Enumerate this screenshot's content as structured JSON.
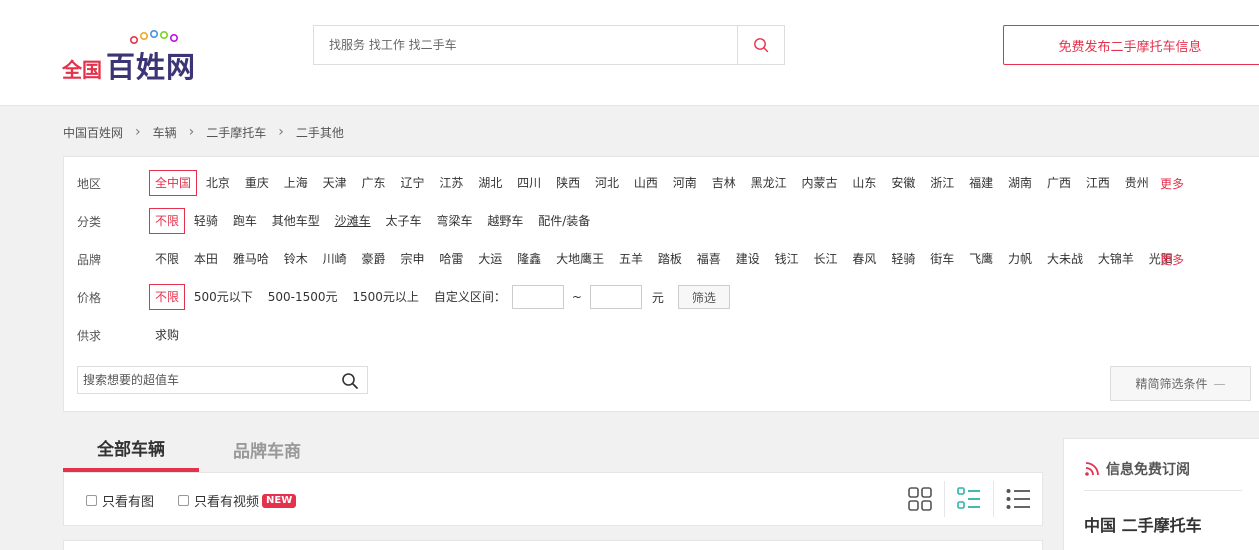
{
  "logo": {
    "prefix": "全国",
    "main": "百姓网"
  },
  "search": {
    "placeholder": "找服务 找工作 找二手车"
  },
  "post_button": "免费发布二手摩托车信息",
  "breadcrumb": [
    "中国百姓网",
    "车辆",
    "二手摩托车",
    "二手其他"
  ],
  "filters": {
    "region": {
      "label": "地区",
      "items": [
        "全中国",
        "北京",
        "重庆",
        "上海",
        "天津",
        "广东",
        "辽宁",
        "江苏",
        "湖北",
        "四川",
        "陕西",
        "河北",
        "山西",
        "河南",
        "吉林",
        "黑龙江",
        "内蒙古",
        "山东",
        "安徽",
        "浙江",
        "福建",
        "湖南",
        "广西",
        "江西",
        "贵州"
      ],
      "selected": "全中国",
      "more": "更多"
    },
    "category": {
      "label": "分类",
      "items": [
        "不限",
        "轻骑",
        "跑车",
        "其他车型",
        "沙滩车",
        "太子车",
        "弯梁车",
        "越野车",
        "配件/装备"
      ],
      "selected": "不限"
    },
    "brand": {
      "label": "品牌",
      "items": [
        "不限",
        "本田",
        "雅马哈",
        "铃木",
        "川崎",
        "豪爵",
        "宗申",
        "哈雷",
        "大运",
        "隆鑫",
        "大地鹰王",
        "五羊",
        "踏板",
        "福喜",
        "建设",
        "钱江",
        "长江",
        "春风",
        "轻骑",
        "街车",
        "飞鹰",
        "力帆",
        "大未战",
        "大锦羊",
        "光阳"
      ],
      "more": "更多"
    },
    "price": {
      "label": "价格",
      "items": [
        "不限",
        "500元以下",
        "500-1500元",
        "1500元以上"
      ],
      "selected": "不限",
      "custom_label": "自定义区间：",
      "tilde": "~",
      "unit": "元",
      "button": "筛选"
    },
    "supply": {
      "label": "供求",
      "items": [
        "求购"
      ]
    },
    "search_placeholder": "搜索想要的超值车",
    "simplify_button": "精简筛选条件"
  },
  "tabs": [
    "全部车辆",
    "品牌车商"
  ],
  "listbar": {
    "only_images": "只看有图",
    "only_video": "只看有视频",
    "new_badge": "NEW"
  },
  "sidebar": {
    "title": "信息免费订阅",
    "subtitle": "中国 二手摩托车"
  },
  "colors": {
    "accent": "#e5324c",
    "logo_blue": "#3b3576",
    "background": "#f1f1f1"
  }
}
